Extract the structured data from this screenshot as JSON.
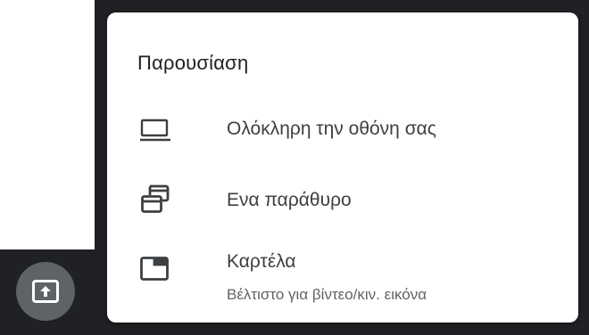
{
  "menu": {
    "title": "Παρουσίαση",
    "items": [
      {
        "icon": "laptop-icon",
        "label": "Ολόκληρη την οθόνη σας"
      },
      {
        "icon": "window-icon",
        "label": "Ενα παράθυρο"
      },
      {
        "icon": "browser-tab-icon",
        "label": "Καρτέλα",
        "sublabel": "Βέλτιστο για βίντεο/κιν. εικόνα"
      }
    ]
  },
  "dock": {
    "present_button": {
      "icon": "present-to-all-icon"
    }
  },
  "colors": {
    "background": "#202124",
    "menu_background": "#ffffff",
    "button_background": "#5f6368",
    "text_primary": "#3c4043",
    "text_secondary": "#5f6368"
  }
}
